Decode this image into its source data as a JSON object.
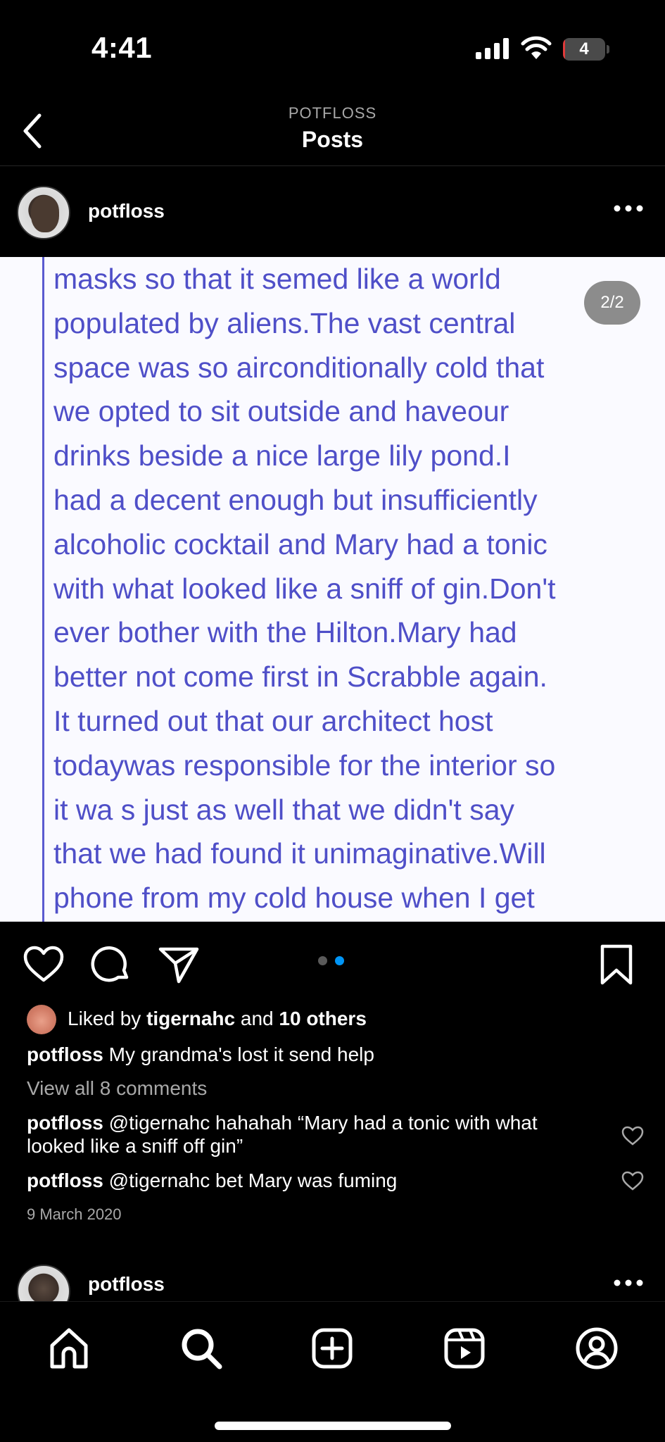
{
  "status_bar": {
    "time": "4:41",
    "battery_level": "4",
    "battery_fraction": 0.04
  },
  "nav": {
    "subtitle": "POTFLOSS",
    "title": "Posts"
  },
  "post": {
    "username": "potfloss",
    "carousel_counter": "2/2",
    "image_text_lines": [
      "masks so that it semed like a world",
      "populated by aliens.The vast central",
      "space was so airconditionally cold that",
      "we opted to sit outside and haveour",
      "drinks beside a nice large lily pond.I",
      "had a decent enough but insufficiently",
      "alcoholic cocktail and Mary had a tonic",
      "with what looked like a sniff of gin.Don't",
      "ever bother with the Hilton.Mary had",
      "better not come first in Scrabble again.",
      "It turned out that our architect host",
      "todaywas responsible for the interior so",
      "it wa s just as well that we didn't say",
      "that we had found it unimaginative.Will",
      "phone from my cold house when I get"
    ],
    "carousel": {
      "total": 2,
      "active_index": 1
    },
    "likes": {
      "prefix": "Liked by ",
      "liker": "tigernahc",
      "middle": " and ",
      "others": "10 others"
    },
    "caption": {
      "username": "potfloss",
      "text": "My grandma's lost it send help"
    },
    "view_comments": "View all 8 comments",
    "comments": [
      {
        "username": "potfloss",
        "text": "@tigernahc hahahah “Mary had a tonic with what looked like a sniff off gin”"
      },
      {
        "username": "potfloss",
        "text": "@tigernahc bet Mary was fuming"
      }
    ],
    "date": "9 March 2020"
  },
  "next_post": {
    "username": "potfloss"
  },
  "icons": {
    "back": "chevron-left-icon",
    "more": "more-horizontal-icon",
    "like": "heart-icon",
    "comment": "comment-bubble-icon",
    "share": "paper-plane-icon",
    "save": "bookmark-icon",
    "tabs": [
      "home-icon",
      "search-icon",
      "new-post-icon",
      "reels-icon",
      "profile-icon"
    ]
  },
  "colors": {
    "background": "#000000",
    "image_text": "#4f4fc8",
    "carousel_dot_active": "#0095f6",
    "secondary_text": "#a8a8a8"
  }
}
